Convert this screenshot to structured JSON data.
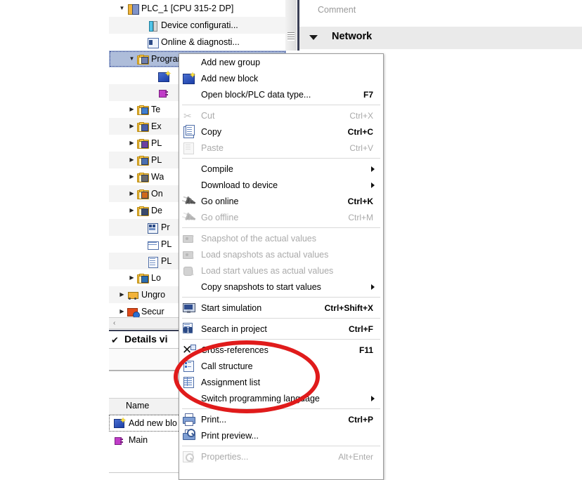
{
  "tree": {
    "rows": [
      {
        "label": "PLC_1 [CPU 315-2 DP]",
        "indent": 12,
        "expander": "▼",
        "icon": "plc-icon",
        "selected": false
      },
      {
        "label": "Device configurati...",
        "indent": 40,
        "expander": "",
        "icon": "device-config-icon",
        "selected": false
      },
      {
        "label": "Online & diagnosti...",
        "indent": 40,
        "expander": "",
        "icon": "online-diagnostics-icon",
        "selected": false
      },
      {
        "label": "Program blocks",
        "indent": 26,
        "expander": "▼",
        "icon": "program-blocks-folder-icon",
        "selected": true
      },
      {
        "label": "",
        "indent": 56,
        "expander": "",
        "icon": "add-new-block-icon",
        "selected": false
      },
      {
        "label": "",
        "indent": 56,
        "expander": "",
        "icon": "main-block-icon",
        "selected": false
      },
      {
        "label": "Te",
        "indent": 26,
        "expander": "▶",
        "icon": "technology-objects-folder-icon",
        "selected": false
      },
      {
        "label": "Ex",
        "indent": 26,
        "expander": "▶",
        "icon": "external-source-files-folder-icon",
        "selected": false
      },
      {
        "label": "PL",
        "indent": 26,
        "expander": "▶",
        "icon": "plc-tags-folder-icon",
        "selected": false
      },
      {
        "label": "PL",
        "indent": 26,
        "expander": "▶",
        "icon": "plc-data-types-folder-icon",
        "selected": false
      },
      {
        "label": "Wa",
        "indent": 26,
        "expander": "▶",
        "icon": "watch-tables-folder-icon",
        "selected": false
      },
      {
        "label": "On",
        "indent": 26,
        "expander": "▶",
        "icon": "online-backups-folder-icon",
        "selected": false
      },
      {
        "label": "De",
        "indent": 26,
        "expander": "▶",
        "icon": "device-proxy-folder-icon",
        "selected": false
      },
      {
        "label": "Pr",
        "indent": 40,
        "expander": "",
        "icon": "program-info-icon",
        "selected": false
      },
      {
        "label": "PL",
        "indent": 40,
        "expander": "",
        "icon": "plc-alarms-icon",
        "selected": false
      },
      {
        "label": "PL",
        "indent": 40,
        "expander": "",
        "icon": "plc-text-lists-icon",
        "selected": false
      },
      {
        "label": "Lo",
        "indent": 26,
        "expander": "▶",
        "icon": "local-modules-folder-icon",
        "selected": false
      },
      {
        "label": "Ungro",
        "indent": 12,
        "expander": "▶",
        "icon": "ungrouped-devices-icon",
        "selected": false
      },
      {
        "label": "Secur",
        "indent": 12,
        "expander": "▶",
        "icon": "security-settings-icon",
        "selected": false
      }
    ]
  },
  "editor": {
    "comment_placeholder": "Comment",
    "network_label": "Network",
    "collapse_icon": "triangle-down-icon"
  },
  "details_view": {
    "title": "Details vi",
    "check_mark": "✔",
    "scroll_left_icon": "‹",
    "column_name": "Name",
    "rows": [
      {
        "label": "Add new blo",
        "icon": "add-new-block-icon",
        "selected": true
      },
      {
        "label": "Main",
        "icon": "main-ob-icon",
        "selected": false
      }
    ]
  },
  "context_menu": {
    "groups": [
      {
        "items": [
          {
            "label": "Add new group",
            "shortcut": "",
            "icon": "",
            "disabled": false,
            "submenu": false
          },
          {
            "label": "Add new block",
            "shortcut": "",
            "icon": "add-new-block-icon",
            "disabled": false,
            "submenu": false
          },
          {
            "label": "Open block/PLC data type...",
            "shortcut": "F7",
            "icon": "",
            "disabled": false,
            "submenu": false
          }
        ]
      },
      {
        "items": [
          {
            "label": "Cut",
            "shortcut": "Ctrl+X",
            "icon": "scissors-icon",
            "disabled": true,
            "submenu": false
          },
          {
            "label": "Copy",
            "shortcut": "Ctrl+C",
            "icon": "copy-icon",
            "disabled": false,
            "submenu": false
          },
          {
            "label": "Paste",
            "shortcut": "Ctrl+V",
            "icon": "paste-icon",
            "disabled": true,
            "submenu": false
          }
        ]
      },
      {
        "items": [
          {
            "label": "Compile",
            "shortcut": "",
            "icon": "",
            "disabled": false,
            "submenu": true
          },
          {
            "label": "Download to device",
            "shortcut": "",
            "icon": "",
            "disabled": false,
            "submenu": true
          },
          {
            "label": "Go online",
            "shortcut": "Ctrl+K",
            "icon": "go-online-icon",
            "disabled": false,
            "submenu": false
          },
          {
            "label": "Go offline",
            "shortcut": "Ctrl+M",
            "icon": "go-offline-icon",
            "disabled": true,
            "submenu": false
          }
        ]
      },
      {
        "items": [
          {
            "label": "Snapshot of the actual values",
            "shortcut": "",
            "icon": "snapshot-icon",
            "disabled": true,
            "submenu": false
          },
          {
            "label": "Load snapshots as actual values",
            "shortcut": "",
            "icon": "load-snapshot-icon",
            "disabled": true,
            "submenu": false
          },
          {
            "label": "Load start values as actual values",
            "shortcut": "",
            "icon": "load-start-values-icon",
            "disabled": true,
            "submenu": false
          },
          {
            "label": "Copy snapshots to start values",
            "shortcut": "",
            "icon": "",
            "disabled": false,
            "submenu": true
          }
        ]
      },
      {
        "items": [
          {
            "label": "Start simulation",
            "shortcut": "Ctrl+Shift+X",
            "icon": "simulation-icon",
            "disabled": false,
            "submenu": false
          }
        ]
      },
      {
        "items": [
          {
            "label": "Search in project",
            "shortcut": "Ctrl+F",
            "icon": "search-icon",
            "disabled": false,
            "submenu": false
          }
        ]
      },
      {
        "items": [
          {
            "label": "Cross-references",
            "shortcut": "F11",
            "icon": "cross-references-icon",
            "disabled": false,
            "submenu": false
          },
          {
            "label": "Call structure",
            "shortcut": "",
            "icon": "call-structure-icon",
            "disabled": false,
            "submenu": false
          },
          {
            "label": "Assignment list",
            "shortcut": "",
            "icon": "assignment-list-icon",
            "disabled": false,
            "submenu": false
          },
          {
            "label": "Switch programming language",
            "shortcut": "",
            "icon": "",
            "disabled": false,
            "submenu": true
          }
        ]
      },
      {
        "items": [
          {
            "label": "Print...",
            "shortcut": "Ctrl+P",
            "icon": "print-icon",
            "disabled": false,
            "submenu": false
          },
          {
            "label": "Print preview...",
            "shortcut": "",
            "icon": "print-preview-icon",
            "disabled": false,
            "submenu": false
          }
        ]
      },
      {
        "items": [
          {
            "label": "Properties...",
            "shortcut": "Alt+Enter",
            "icon": "properties-icon",
            "disabled": true,
            "submenu": false
          }
        ]
      }
    ]
  },
  "annotation": {
    "shape": "ellipse",
    "color": "#e01b1b",
    "highlights": [
      "Cross-references",
      "Call structure",
      "Assignment list"
    ]
  }
}
